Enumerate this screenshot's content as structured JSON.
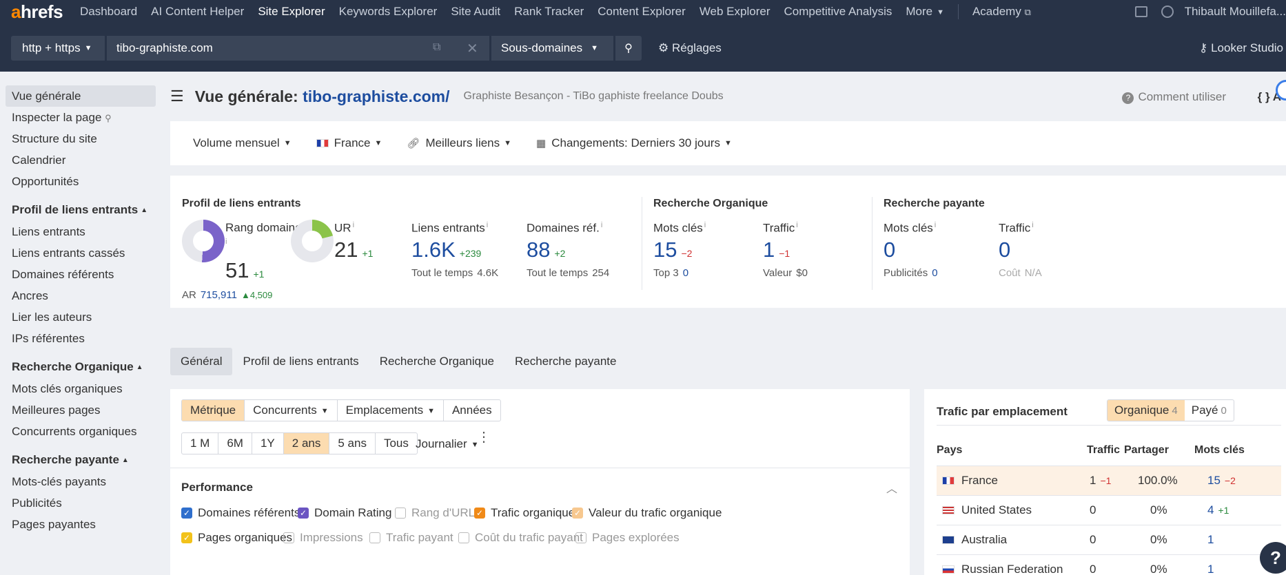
{
  "brand": {
    "logo_a": "a",
    "logo_rest": "hrefs"
  },
  "topnav": {
    "items": [
      "Dashboard",
      "AI Content Helper",
      "Site Explorer",
      "Keywords Explorer",
      "Site Audit",
      "Rank Tracker",
      "Content Explorer",
      "Web Explorer",
      "Competitive Analysis",
      "More"
    ],
    "active": "Site Explorer",
    "academy": "Academy",
    "user": "Thibault Mouillefa..."
  },
  "urlbar": {
    "protocol": "http + https",
    "url": "tibo-graphiste.com",
    "mode": "Sous-domaines",
    "settings": "Réglages",
    "looker": "Looker Studio"
  },
  "sidebar": {
    "items": [
      "Vue générale",
      "Inspecter la page",
      "Structure du site",
      "Calendrier",
      "Opportunités"
    ],
    "sections": [
      {
        "title": "Profil de liens entrants",
        "items": [
          "Liens entrants",
          "Liens entrants cassés",
          "Domaines référents",
          "Ancres",
          "Lier les auteurs",
          "IPs référentes"
        ]
      },
      {
        "title": "Recherche Organique",
        "items": [
          "Mots clés organiques",
          "Meilleures pages",
          "Concurrents organiques"
        ]
      },
      {
        "title": "Recherche payante",
        "items": [
          "Mots-clés payants",
          "Publicités",
          "Pages payantes"
        ]
      }
    ]
  },
  "header": {
    "title_prefix": "Vue générale:",
    "domain": "tibo-graphiste.com/",
    "subtitle": "Graphiste Besançon - TiBo gaphiste freelance Doubs",
    "howto": "Comment utiliser",
    "api": "{ } A"
  },
  "filters": {
    "volume": "Volume mensuel",
    "country": "France",
    "links": "Meilleurs liens",
    "changes": "Changements: Derniers 30 jours"
  },
  "metrics": {
    "backlink_profile": {
      "title": "Profil de liens entrants",
      "dr": {
        "label": "Rang domaine",
        "value": "51",
        "delta": "+1",
        "fill": 0.51
      },
      "ar": {
        "label": "AR",
        "value": "715,911",
        "delta": "4,509"
      },
      "ur": {
        "label": "UR",
        "value": "21",
        "delta": "+1",
        "fill": 0.21
      },
      "backlinks": {
        "label": "Liens entrants",
        "value": "1.6K",
        "delta": "+239",
        "sub_label": "Tout le temps",
        "sub_value": "4.6K"
      },
      "ref_domains": {
        "label": "Domaines réf.",
        "value": "88",
        "delta": "+2",
        "sub_label": "Tout le temps",
        "sub_value": "254"
      }
    },
    "organic": {
      "title": "Recherche Organique",
      "keywords": {
        "label": "Mots clés",
        "value": "15",
        "delta": "−2",
        "sub_label": "Top 3",
        "sub_value": "0"
      },
      "traffic": {
        "label": "Traffic",
        "value": "1",
        "delta": "−1",
        "sub_label": "Valeur",
        "sub_value": "$0"
      }
    },
    "paid": {
      "title": "Recherche payante",
      "keywords": {
        "label": "Mots clés",
        "value": "0",
        "sub_label": "Publicités",
        "sub_value": "0"
      },
      "traffic": {
        "label": "Traffic",
        "value": "0",
        "sub_label": "Coût",
        "sub_value": "N/A"
      }
    }
  },
  "tabs": [
    "Général",
    "Profil de liens entrants",
    "Recherche Organique",
    "Recherche payante"
  ],
  "performance": {
    "modes": [
      "Métrique",
      "Concurrents",
      "Emplacements",
      "Années"
    ],
    "ranges": [
      "1 M",
      "6M",
      "1Y",
      "2 ans",
      "5 ans",
      "Tous"
    ],
    "selected_range": "2 ans",
    "interval": "Journalier",
    "title": "Performance",
    "checkboxes": [
      {
        "label": "Domaines référents",
        "checked": true,
        "color": "#2f6fcd"
      },
      {
        "label": "Domain Rating",
        "checked": true,
        "color": "#6b55c2"
      },
      {
        "label": "Rang d'URL",
        "checked": false
      },
      {
        "label": "Trafic organique",
        "checked": true,
        "color": "#f08a18"
      },
      {
        "label": "Valeur du trafic organique",
        "checked": true,
        "color": "#f7c88f"
      },
      {
        "label": "Pages organiques",
        "checked": true,
        "color": "#f2c21b"
      },
      {
        "label": "Impressions",
        "checked": false
      },
      {
        "label": "Trafic payant",
        "checked": false
      },
      {
        "label": "Coût du trafic payant",
        "checked": false
      },
      {
        "label": "Pages explorées",
        "checked": false
      }
    ]
  },
  "locations": {
    "title": "Trafic par emplacement",
    "toggle_organic": "Organique",
    "toggle_organic_count": "4",
    "toggle_paid": "Payé",
    "toggle_paid_count": "0",
    "columns": [
      "Pays",
      "Traffic",
      "Partager",
      "Mots clés"
    ],
    "rows": [
      {
        "country": "France",
        "traffic": "1",
        "traffic_delta": "−1",
        "share": "100.0%",
        "keywords": "15",
        "keywords_delta": "−2"
      },
      {
        "country": "United States",
        "traffic": "0",
        "share": "0%",
        "keywords": "4",
        "keywords_delta": "+1"
      },
      {
        "country": "Australia",
        "traffic": "0",
        "share": "0%",
        "keywords": "1"
      },
      {
        "country": "Russian Federation",
        "traffic": "0",
        "share": "0%",
        "keywords": "1"
      }
    ]
  },
  "colors": {
    "nav_bg": "#283347",
    "accent_orange": "#ff8800",
    "link_blue": "#1d4d9f",
    "selected_bg": "#fcdcb0"
  }
}
